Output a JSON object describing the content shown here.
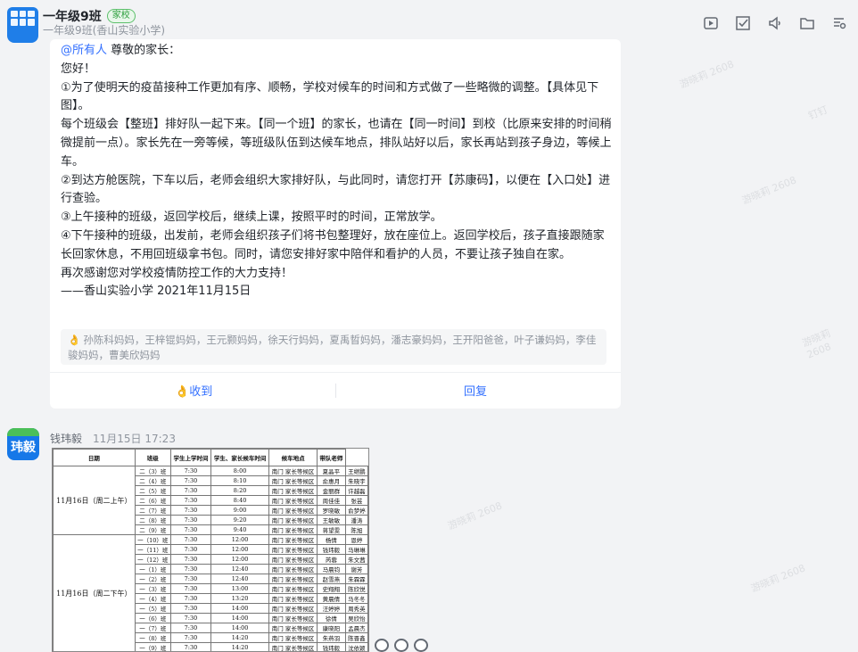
{
  "header": {
    "title": "一年级9班",
    "badge": "家校",
    "subtitle": "一年级9班(香山实验小学)",
    "tools": [
      "video-icon",
      "task-icon",
      "announcement-icon",
      "folder-icon",
      "settings-icon"
    ]
  },
  "message": {
    "mention": "@所有人",
    "lines": [
      " 尊敬的家长：",
      "您好！",
      "①为了使明天的疫苗接种工作更加有序、顺畅，学校对候车的时间和方式做了一些略微的调整。【具体见下图】。",
      "每个班级会【整班】排好队一起下来。【同一个班】的家长，也请在【同一时间】到校（比原来安排的时间稍微提前一点）。家长先在一旁等候，等班级队伍到达候车地点，排队站好以后，家长再站到孩子身边，等候上车。",
      "②到达方舱医院，下车以后，老师会组织大家排好队，与此同时，请您打开【苏康码】，以便在【入口处】进行查验。",
      "③上午接种的班级，返回学校后，继续上课，按照平时的时间，正常放学。",
      "④下午接种的班级，出发前，老师会组织孩子们将书包整理好，放在座位上。返回学校后，孩子直接跟随家长回家休息，不用回班级拿书包。同时，请您安排好家中陪伴和看护的人员，不要让孩子独自在家。",
      "再次感谢您对学校疫情防控工作的大力支持！",
      "——香山实验小学 2021年11月15日"
    ],
    "readers": "孙陈科妈妈，王梓锟妈妈，王元颢妈妈，徐天行妈妈，夏禹晢妈妈，潘志豪妈妈，王开阳爸爸，叶子谦妈妈，李佳骏妈妈，曹美欣妈妈",
    "receive_label": "收到",
    "reply_label": "回复"
  },
  "next_message": {
    "avatar_text": "玮毅",
    "sender": "钱玮毅",
    "time": "11月15日 17:23"
  },
  "schedule": {
    "headers": [
      "日期",
      "班级",
      "学生上学时间",
      "学生、家长候车时间",
      "候车地点",
      "带队老师"
    ],
    "morning_date": "11月16日（周二上午）",
    "afternoon_date": "11月16日（周二下午）",
    "rows": [
      [
        "二（3）班",
        "7:30",
        "8:00",
        "南门 家长等候区",
        "夏晶平",
        "王继鹏"
      ],
      [
        "二（4）班",
        "7:30",
        "8:10",
        "南门 家长等候区",
        "俞惠月",
        "朱晓宇"
      ],
      [
        "二（5）班",
        "7:30",
        "8:20",
        "南门 家长等候区",
        "金丽群",
        "许越磊"
      ],
      [
        "二（6）班",
        "7:30",
        "8:40",
        "南门 家长等候区",
        "周佳佳",
        "张芸"
      ],
      [
        "二（7）班",
        "7:30",
        "9:00",
        "南门 家长等候区",
        "罗晓敏",
        "俞梦婷"
      ],
      [
        "二（8）班",
        "7:30",
        "9:20",
        "南门 家长等候区",
        "王敏敏",
        "潘涛"
      ],
      [
        "二（9）班",
        "7:30",
        "9:40",
        "南门 家长等候区",
        "蒋望雯",
        "陈旭"
      ],
      [
        "一（10）班",
        "7:30",
        "12:00",
        "南门 家长等候区",
        "杨倩",
        "恩婷"
      ],
      [
        "一（11）班",
        "7:30",
        "12:00",
        "南门 家长等候区",
        "钱玮毅",
        "马琳琳"
      ],
      [
        "一（12）班",
        "7:30",
        "12:00",
        "南门 家长等候区",
        "芮蓉",
        "朱文茜"
      ],
      [
        "一（1）班",
        "7:30",
        "12:40",
        "南门 家长等候区",
        "马晨钧",
        "谢芳"
      ],
      [
        "一（2）班",
        "7:30",
        "12:40",
        "南门 家长等候区",
        "赵雪燕",
        "朱霖霖"
      ],
      [
        "一（3）班",
        "7:30",
        "13:00",
        "南门 家长等候区",
        "史翔翔",
        "陈欣悦"
      ],
      [
        "一（4）班",
        "7:30",
        "13:20",
        "南门 家长等候区",
        "黄晨倩",
        "马冬冬"
      ],
      [
        "一（5）班",
        "7:30",
        "14:00",
        "南门 家长等候区",
        "汪婷婷",
        "周秀英"
      ],
      [
        "一（6）班",
        "7:30",
        "14:00",
        "南门 家长等候区",
        "徐倩",
        "吴欣怡"
      ],
      [
        "一（7）班",
        "7:30",
        "14:00",
        "南门 家长等候区",
        "康晓阳",
        "孟晨杰"
      ],
      [
        "一（8）班",
        "7:30",
        "14:20",
        "南门 家长等候区",
        "朱燕羽",
        "陈晋鑫"
      ],
      [
        "一（9）班",
        "7:30",
        "14:20",
        "南门 家长等候区",
        "钱玮毅",
        "沈依颖"
      ]
    ]
  },
  "watermark": "游晓莉 2608",
  "watermark_alt": "钉钉"
}
